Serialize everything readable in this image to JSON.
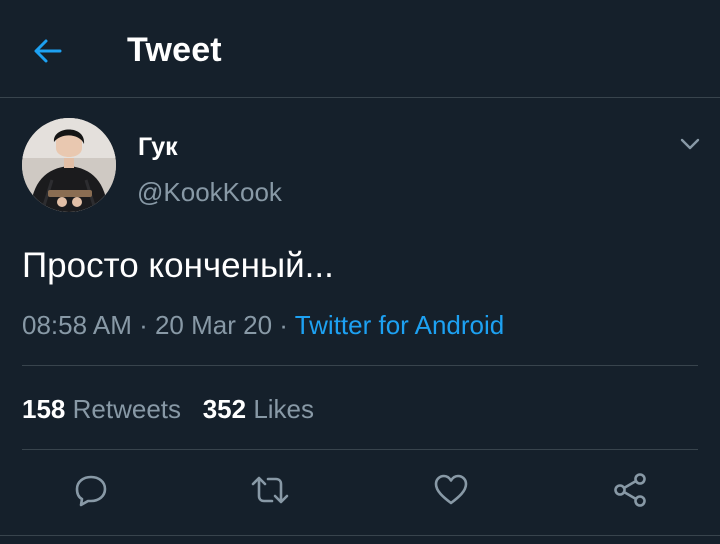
{
  "header": {
    "title": "Tweet",
    "back_icon": "arrow-left-icon"
  },
  "colors": {
    "background": "#15202b",
    "accent": "#1da1f2",
    "secondary_text": "#8899a6",
    "divider": "#38444d"
  },
  "tweet": {
    "author": {
      "display_name": "Гук",
      "username": "@KookKook"
    },
    "text": "Просто конченый...",
    "time": "08:58 AM",
    "separator": " · ",
    "date": "20 Mar 20",
    "source": "Twitter for Android"
  },
  "stats": {
    "retweets_count": "158",
    "retweets_label": "Retweets",
    "likes_count": "352",
    "likes_label": "Likes"
  },
  "actions": {
    "reply_icon": "reply-icon",
    "retweet_icon": "retweet-icon",
    "like_icon": "heart-icon",
    "share_icon": "share-icon"
  }
}
